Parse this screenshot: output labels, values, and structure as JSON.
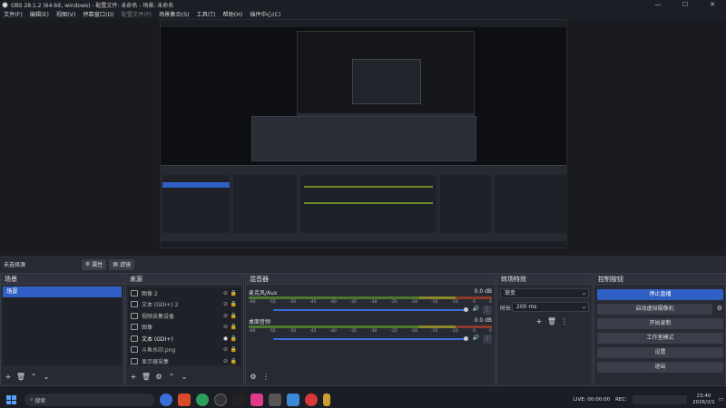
{
  "window": {
    "title": "OBS 28.1.2 (64-bit, windows) - 配置文件: 未命名 - 场景: 未命名"
  },
  "menu": [
    "文件(F)",
    "编辑(E)",
    "视图(V)",
    "停靠窗口(D)",
    "配置文件(P)",
    "场景集合(S)",
    "工具(T)",
    "帮助(H)",
    "插件中心(C)"
  ],
  "menu_disabled": [
    4
  ],
  "scene_bar": {
    "label": "未选择源",
    "props": "属性",
    "filters": "滤镜"
  },
  "docks": {
    "scenes": {
      "title": "场景",
      "items": [
        "场景"
      ]
    },
    "sources": {
      "title": "来源",
      "items": [
        "图像 2",
        "文本 (GDI+) 2",
        "视频采集设备",
        "图像",
        "文本 (GDI+)",
        "斗鱼水印.png",
        "显示器采集"
      ]
    },
    "mixer": {
      "title": "混音器",
      "channels": [
        {
          "name": "麦克风/Aux",
          "db": "0.0 dB"
        },
        {
          "name": "桌面音频",
          "db": "0.0 dB"
        }
      ],
      "ticks": [
        "-60",
        "-55",
        "-50",
        "-45",
        "-40",
        "-35",
        "-30",
        "-25",
        "-20",
        "-15",
        "-10",
        "-5",
        "0"
      ]
    },
    "transitions": {
      "title": "转场特效",
      "type": "渐变",
      "duration_label": "时长",
      "duration": "200 ms"
    },
    "controls": {
      "title": "控制按钮",
      "buttons": [
        "停止直播",
        "启动虚拟摄像机",
        "开始录制",
        "工作室模式",
        "设置",
        "退出"
      ]
    }
  },
  "taskbar": {
    "search": "搜索",
    "live": "LIVE: 00:00:00",
    "rec": "REC:",
    "time": "23:40",
    "date": "2026/2/1"
  },
  "colors": {
    "accent": "#2f5fc4",
    "panel": "#272a33"
  }
}
